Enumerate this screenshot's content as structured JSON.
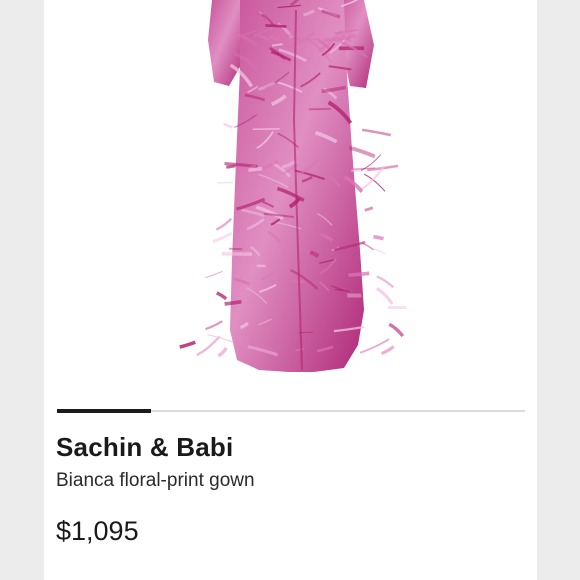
{
  "product": {
    "brand": "Sachin & Babi",
    "name": "Bianca floral-print gown",
    "price": "$1,095",
    "image_icon": "dress-image",
    "dress_colors": [
      "#b2216f",
      "#d974b2",
      "#f2c3e1"
    ]
  },
  "carousel": {
    "progress_fraction": 0.2
  }
}
